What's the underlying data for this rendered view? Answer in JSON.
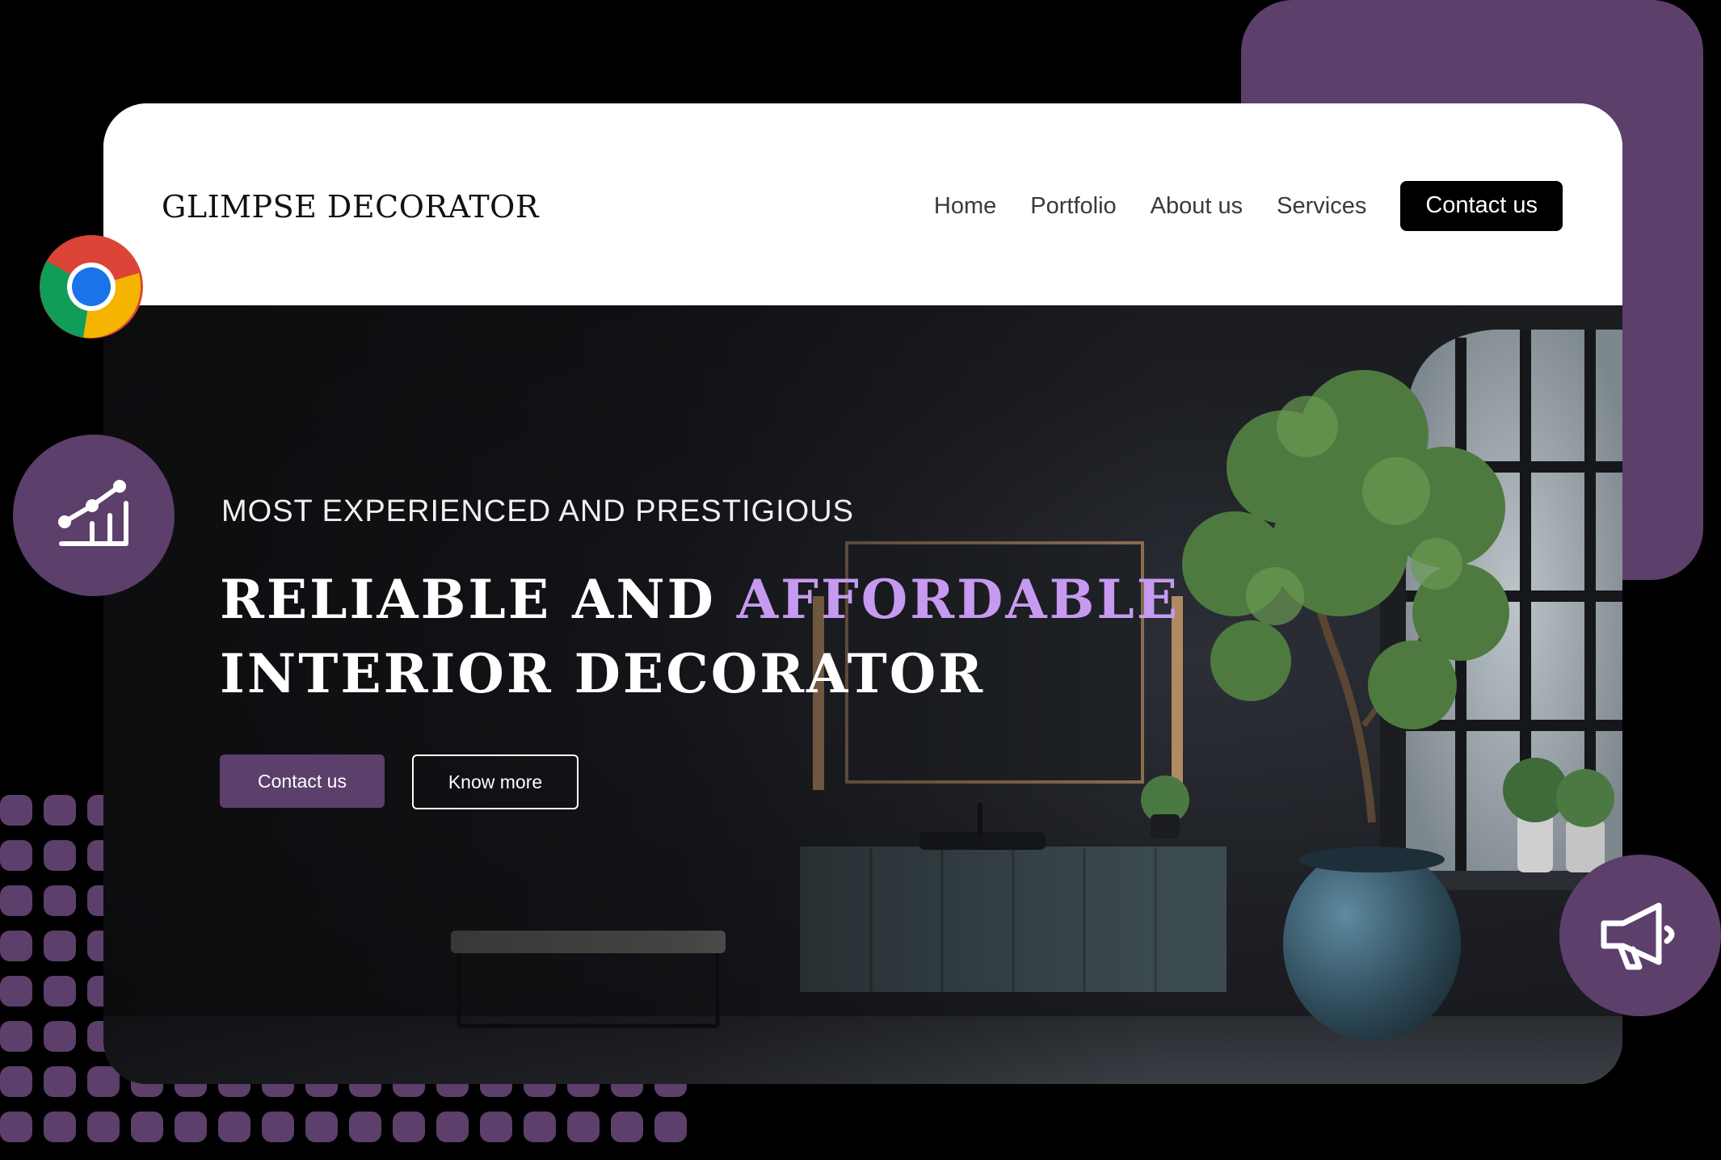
{
  "brand": {
    "name": "GLIMPSE DECORATOR"
  },
  "nav": {
    "links": [
      "Home",
      "Portfolio",
      "About us",
      "Services"
    ],
    "cta": "Contact us"
  },
  "hero": {
    "eyebrow": "MOST EXPERIENCED AND PRESTIGIOUS",
    "headline_part1": "RELIABLE AND ",
    "headline_accent": "AFFORDABLE",
    "headline_line2": "INTERIOR DECORATOR",
    "primary_button": "Contact us",
    "secondary_button": "Know more"
  },
  "icons": {
    "browser": "chrome-icon",
    "growth": "growth-chart-icon",
    "marketing": "megaphone-icon"
  },
  "colors": {
    "accent_purple": "#5c3f6b",
    "headline_accent": "#c69af0",
    "nav_cta_bg": "#000000"
  }
}
